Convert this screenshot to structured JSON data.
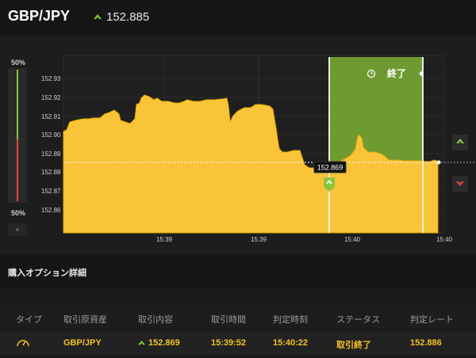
{
  "header": {
    "pair": "GBP/JPY",
    "current_price": "152.885",
    "price_icon": "up-arrow-icon"
  },
  "gauge": {
    "top_percent": "50%",
    "bottom_percent": "50%",
    "close_symbol": "×"
  },
  "chart": {
    "end_label": "終了",
    "marker_price": "152.869",
    "y_ticks": [
      "152.93",
      "152.92",
      "152.91",
      "152.90",
      "152.89",
      "152.88",
      "152.87",
      "152.86"
    ],
    "x_ticks": [
      "15:39",
      "15:39",
      "15:40",
      "15:40"
    ],
    "colors": {
      "area": "#f9c43a",
      "window": "#7aa33a",
      "up": "#8cc63f",
      "down": "#e04b3a"
    }
  },
  "side_buttons": {
    "high_icon": "up-chevron-icon",
    "low_icon": "down-chevron-icon"
  },
  "details": {
    "title": "購入オプション詳細",
    "columns": [
      "タイプ",
      "取引原資産",
      "取引内容",
      "取引時間",
      "判定時刻",
      "ステータス",
      "判定レート"
    ],
    "row": {
      "type_icon": "gauge-icon",
      "asset": "GBP/JPY",
      "trade": "152.869",
      "trade_time": "15:39:52",
      "judge_time": "15:40:22",
      "status": "取引終了",
      "judge_rate": "152.886"
    }
  }
}
